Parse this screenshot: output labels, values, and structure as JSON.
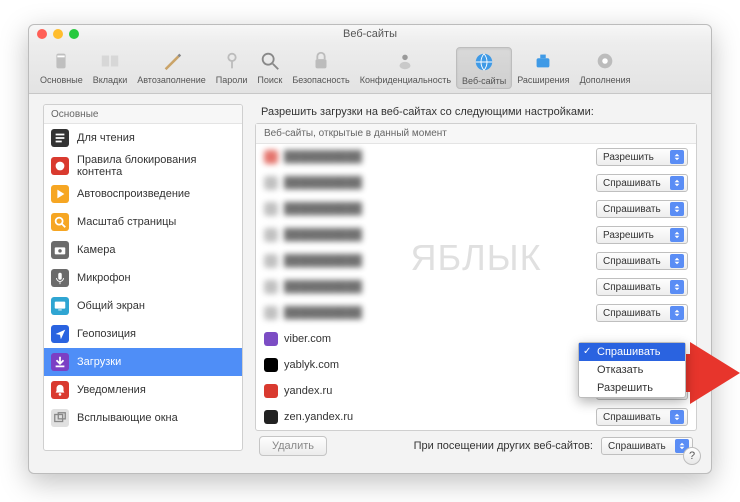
{
  "window": {
    "title": "Веб-сайты"
  },
  "toolbar": [
    {
      "id": "general",
      "label": "Основные",
      "selected": false
    },
    {
      "id": "tabs",
      "label": "Вкладки",
      "selected": false
    },
    {
      "id": "autofill",
      "label": "Автозаполнение",
      "selected": false
    },
    {
      "id": "passwords",
      "label": "Пароли",
      "selected": false
    },
    {
      "id": "search",
      "label": "Поиск",
      "selected": false
    },
    {
      "id": "security",
      "label": "Безопасность",
      "selected": false
    },
    {
      "id": "privacy",
      "label": "Конфиденциальность",
      "selected": false
    },
    {
      "id": "websites",
      "label": "Веб-сайты",
      "selected": true
    },
    {
      "id": "extensions",
      "label": "Расширения",
      "selected": false
    },
    {
      "id": "advanced",
      "label": "Дополнения",
      "selected": false
    }
  ],
  "sidebar": {
    "header": "Основные",
    "items": [
      {
        "id": "reader",
        "label": "Для чтения",
        "color": "#333"
      },
      {
        "id": "contentblock",
        "label": "Правила блокирования контента",
        "color": "#d93a2f"
      },
      {
        "id": "autoplay",
        "label": "Автовоспроизведение",
        "color": "#f6a623"
      },
      {
        "id": "zoom",
        "label": "Масштаб страницы",
        "color": "#f6a623"
      },
      {
        "id": "camera",
        "label": "Камера",
        "color": "#6b6b6b"
      },
      {
        "id": "microphone",
        "label": "Микрофон",
        "color": "#6b6b6b"
      },
      {
        "id": "screenshare",
        "label": "Общий экран",
        "color": "#2fa5d2"
      },
      {
        "id": "location",
        "label": "Геопозиция",
        "color": "#2a63e0"
      },
      {
        "id": "downloads",
        "label": "Загрузки",
        "color": "#7b3fc4",
        "selected": true
      },
      {
        "id": "notifications",
        "label": "Уведомления",
        "color": "#d93a2f"
      },
      {
        "id": "popups",
        "label": "Всплывающие окна",
        "color": "#e0e0e0"
      }
    ]
  },
  "main": {
    "header": "Разрешить загрузки на веб-сайтах со следующими настройками:",
    "list_header": "Веб-сайты, открытые в данный момент",
    "rows": [
      {
        "domain": "",
        "setting": "Разрешить",
        "blurred": true,
        "fav": "#d93a2f"
      },
      {
        "domain": "",
        "setting": "Спрашивать",
        "blurred": true,
        "fav": "#a7a7a7"
      },
      {
        "domain": "",
        "setting": "Спрашивать",
        "blurred": true,
        "fav": "#a7a7a7"
      },
      {
        "domain": "",
        "setting": "Разрешить",
        "blurred": true,
        "fav": "#a7a7a7"
      },
      {
        "domain": "",
        "setting": "Спрашивать",
        "blurred": true,
        "fav": "#a7a7a7"
      },
      {
        "domain": "",
        "setting": "Спрашивать",
        "blurred": true,
        "fav": "#a7a7a7"
      },
      {
        "domain": "",
        "setting": "Спрашивать",
        "blurred": true,
        "fav": "#a7a7a7"
      },
      {
        "domain": "viber.com",
        "setting": "Спрашивать",
        "blurred": false,
        "fav": "#7c4dc4",
        "menu_open": true
      },
      {
        "domain": "yablyk.com",
        "setting": "Спрашивать",
        "blurred": false,
        "fav": "#000"
      },
      {
        "domain": "yandex.ru",
        "setting": "Спрашивать",
        "blurred": false,
        "fav": "#d93a2f"
      },
      {
        "domain": "zen.yandex.ru",
        "setting": "Спрашивать",
        "blurred": false,
        "fav": "#222"
      }
    ],
    "menu_items": [
      {
        "label": "Спрашивать",
        "selected": true
      },
      {
        "label": "Отказать",
        "selected": false
      },
      {
        "label": "Разрешить",
        "selected": false
      }
    ],
    "watermark": "ЯБЛЫК",
    "delete_btn": "Удалить",
    "footer_label": "При посещении других веб-сайтов:",
    "footer_setting": "Спрашивать",
    "help": "?"
  }
}
